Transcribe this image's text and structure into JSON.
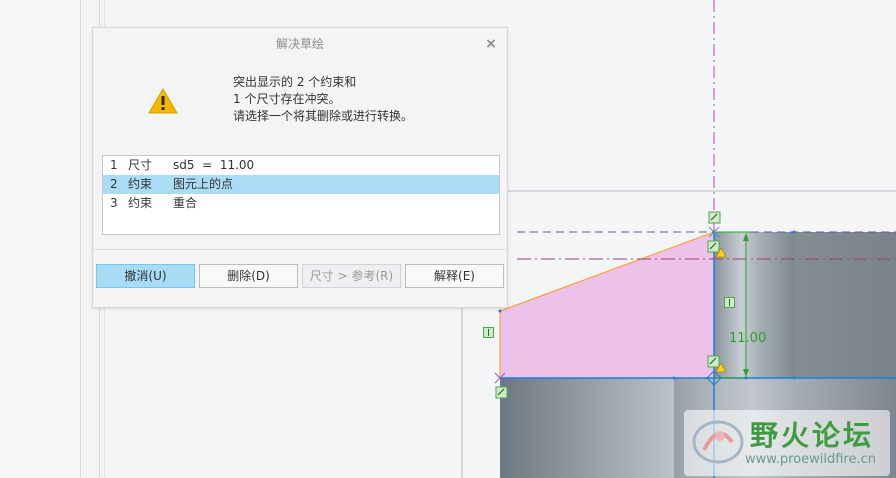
{
  "dialog": {
    "title": "解决草绘",
    "close_glyph": "×",
    "message_lines": [
      "突出显示的 2 个约束和",
      "1 个尺寸存在冲突。",
      "请选择一个将其删除或进行转换。"
    ],
    "conflicts": [
      {
        "index": "1",
        "type": "尺寸",
        "detail": "sd5  =  11.00"
      },
      {
        "index": "2",
        "type": "约束",
        "detail": "图元上的点",
        "selected": true
      },
      {
        "index": "3",
        "type": "约束",
        "detail": "重合"
      }
    ],
    "buttons": {
      "undo": "撤消(U)",
      "delete": "删除(D)",
      "to_reference": "尺寸 > 参考(R)",
      "explain": "解释(E)"
    }
  },
  "sketch": {
    "dimension_value": "11.00"
  },
  "watermark": {
    "site_name": "野火论坛",
    "url": "www.proewildfire.cn"
  },
  "colors": {
    "sketch_fill": "#ecc2ea",
    "dimension_green": "#2ea12e",
    "highlight_orange": "#ff9a1a",
    "selection_blue": "#aadcf6",
    "centerline_magenta": "#c040c0"
  }
}
